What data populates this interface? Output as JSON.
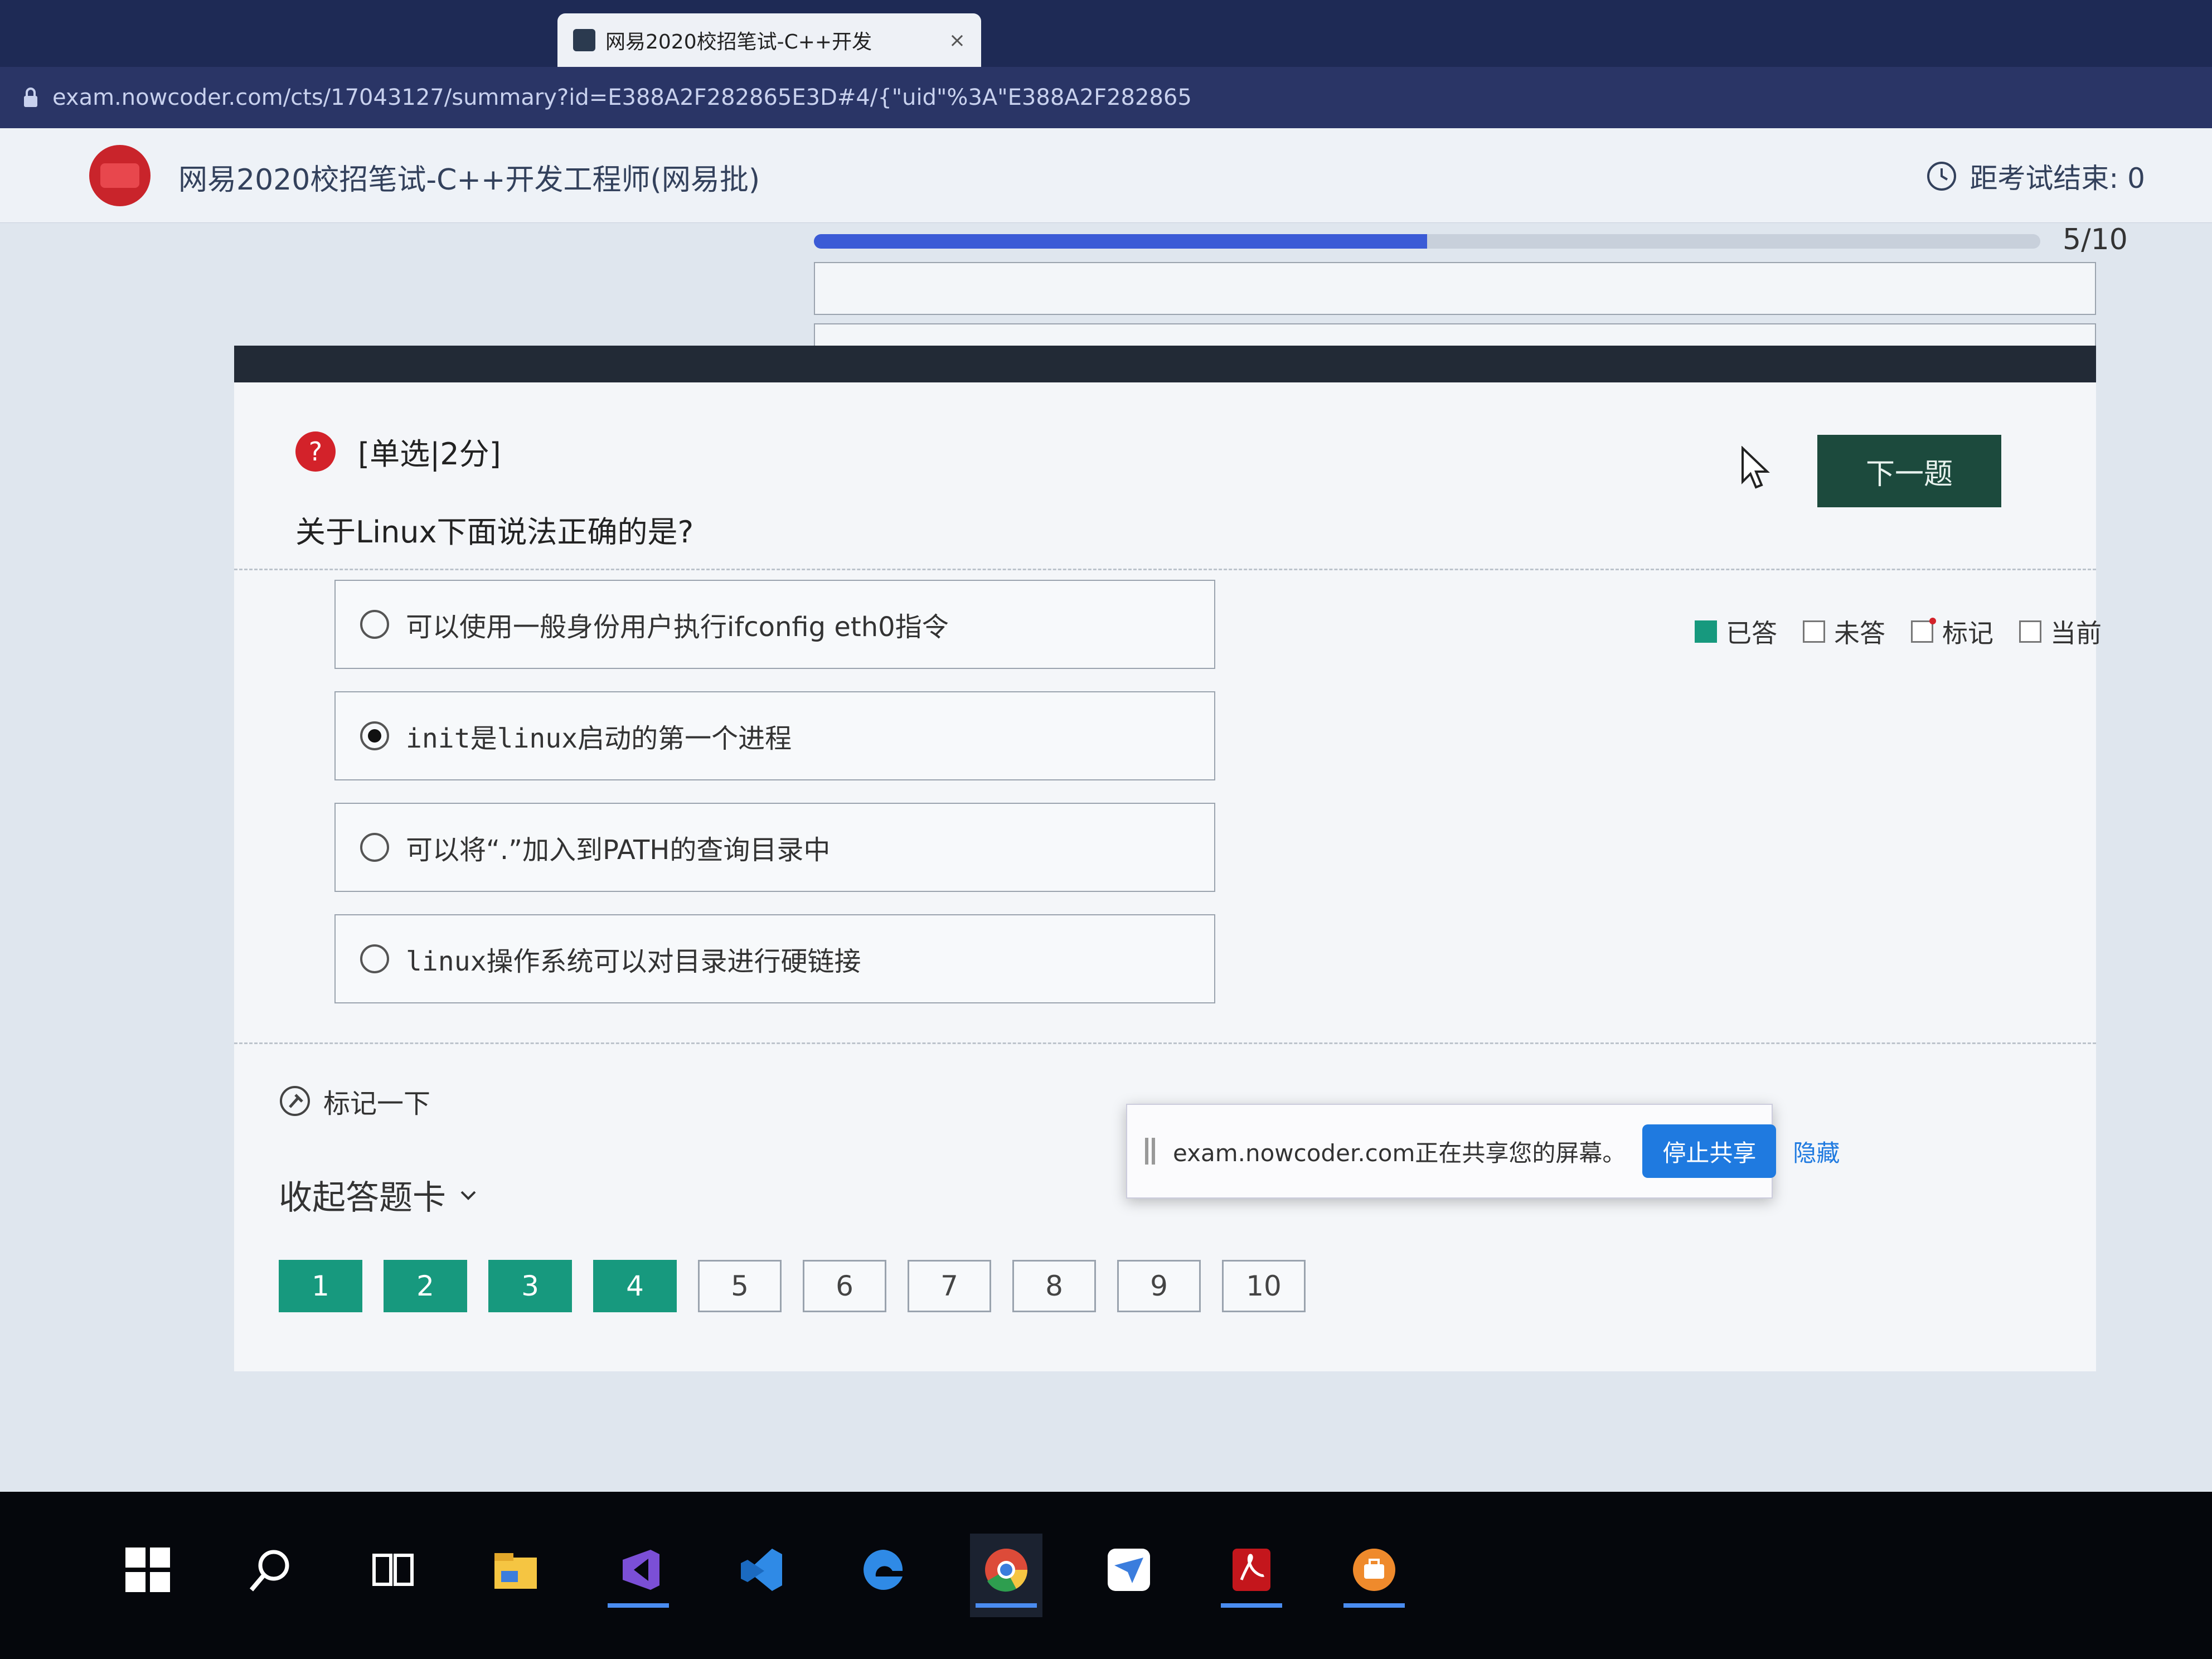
{
  "browser": {
    "tab_title": "网易2020校招笔试-C++开发",
    "tab_close": "×",
    "url": "exam.nowcoder.com/cts/17043127/summary?id=E388A2F282865E3D#4/{\"uid\"%3A\"E388A2F282865"
  },
  "header": {
    "exam_title": "网易2020校招笔试-C++开发工程师(网易批)",
    "timer_label": "距考试结束: 0"
  },
  "progress": {
    "text": "5/10",
    "fraction": 0.5
  },
  "question": {
    "type_label": "[单选|2分]",
    "prompt": "关于Linux下面说法正确的是?",
    "options": [
      {
        "label": "可以使用一般身份用户执行ifconfig eth0指令",
        "selected": false
      },
      {
        "label": "init是linux启动的第一个进程",
        "selected": true
      },
      {
        "label": "可以将“.”加入到PATH的查询目录中",
        "selected": false
      },
      {
        "label": "linux操作系统可以对目录进行硬链接",
        "selected": false
      }
    ],
    "next_label": "下一题",
    "flag_label": "标记一下"
  },
  "legend": {
    "answered": "已答",
    "unanswered": "未答",
    "flagged": "标记",
    "current": "当前"
  },
  "answer_card": {
    "collapse_label": "收起答题卡",
    "numbers": [
      {
        "n": "1",
        "answered": true
      },
      {
        "n": "2",
        "answered": true
      },
      {
        "n": "3",
        "answered": true
      },
      {
        "n": "4",
        "answered": true
      },
      {
        "n": "5",
        "answered": false
      },
      {
        "n": "6",
        "answered": false
      },
      {
        "n": "7",
        "answered": false
      },
      {
        "n": "8",
        "answered": false
      },
      {
        "n": "9",
        "answered": false
      },
      {
        "n": "10",
        "answered": false
      }
    ]
  },
  "share_bar": {
    "text": "exam.nowcoder.com正在共享您的屏幕。",
    "stop_label": "停止共享",
    "hide_label": "隐藏"
  },
  "taskbar": {
    "items": [
      {
        "icon": "windows-start-icon",
        "open": false
      },
      {
        "icon": "search-icon",
        "open": false
      },
      {
        "icon": "task-view-icon",
        "open": false
      },
      {
        "icon": "file-explorer-icon",
        "open": false
      },
      {
        "icon": "visual-studio-icon",
        "open": true
      },
      {
        "icon": "vscode-icon",
        "open": false
      },
      {
        "icon": "edge-icon",
        "open": false
      },
      {
        "icon": "chrome-icon",
        "open": true
      },
      {
        "icon": "feishu-icon",
        "open": false
      },
      {
        "icon": "acrobat-icon",
        "open": true
      },
      {
        "icon": "briefcase-icon",
        "open": true
      }
    ]
  },
  "colors": {
    "answered": "#17997e",
    "next_button": "#1c4a3d",
    "share_button": "#1f7ae0",
    "question_icon": "#d3222a"
  }
}
